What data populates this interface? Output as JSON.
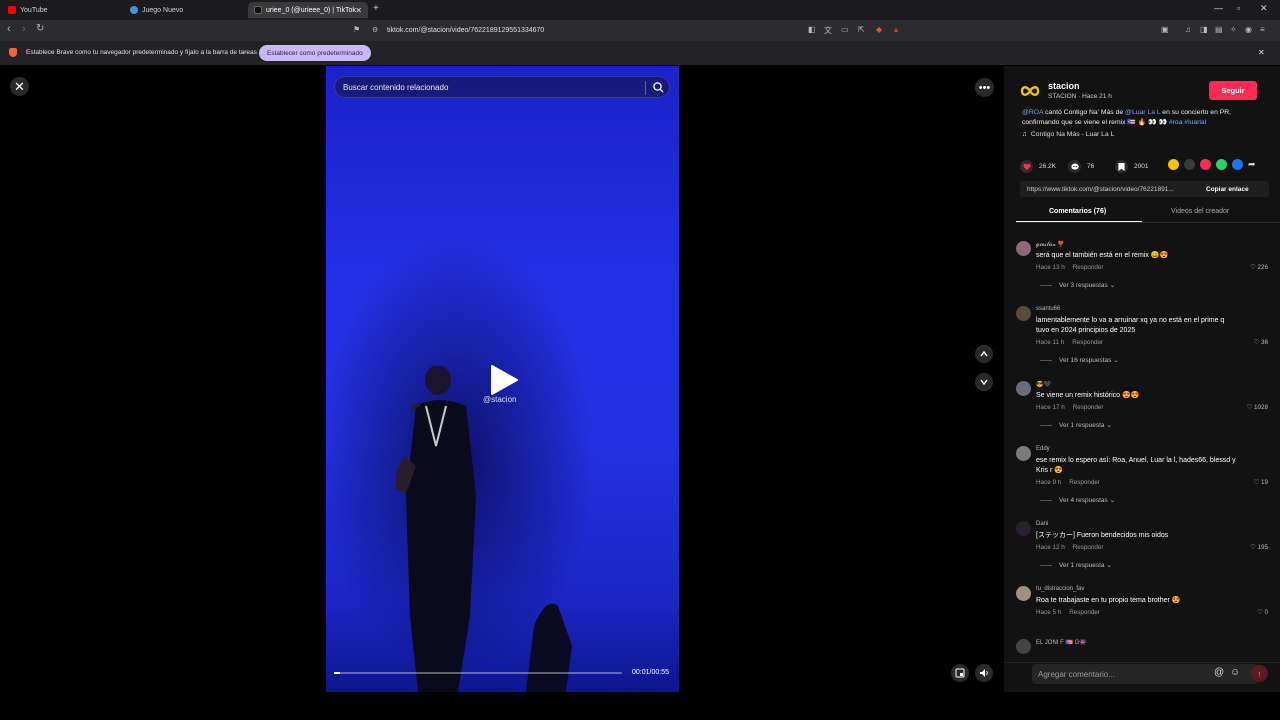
{
  "browser": {
    "tabs": [
      {
        "label": "YouTube",
        "color": "#ff0000"
      },
      {
        "label": "Juego Nuevo",
        "color": "#4a90d9"
      },
      {
        "label": "uriee_0 (@urieee_0) | TikTok",
        "color": "#111111"
      }
    ],
    "url": "tiktok.com/@stacion/video/7622189129551334670",
    "infobar_text": "Establece Brave como tu navegador predeterminado y fíjalo a la barra de tareas",
    "infobar_button": "Establecer como predeterminado"
  },
  "video": {
    "search_placeholder": "Buscar contenido relacionado",
    "watermark": "@stacion",
    "time": "00:01/00:55",
    "progress": 0.02
  },
  "post": {
    "author": "stacion",
    "author_meta": "STACION · Hace 21 h",
    "follow_label": "Seguir",
    "desc_mention1": "@ROA",
    "desc_part1": " cantó Contigo Na' Más de ",
    "desc_mention2": "@Luar La L",
    "desc_part2": " en su concierto en PR, confirmando que se viene el remix ",
    "desc_emoji": "🇵🇷 🔥 👀 👀 ",
    "desc_tags": "#roa #luarlal",
    "music": "Contigo Na Más - Luar La L",
    "likes": "26.2K",
    "comments": "76",
    "saves": "2001",
    "link": "https://www.tiktok.com/@stacion/video/76221891...",
    "copy_label": "Copiar enlace",
    "tab_comments": "Comentarios (76)",
    "tab_videos": "Videos del creador"
  },
  "comments": [
    {
      "user": "𝓰𝓲𝓮𝓼𝓵𝓪𝔁 ❣️",
      "text": "será que el también está en el remix 😄😍",
      "time": "Hace 13 h",
      "reply": "Responder",
      "likes": "226",
      "more": "Ver 3 respuestas ⌄",
      "avatar": "#8a6a7a"
    },
    {
      "user": "ssantu66",
      "text": "lamentablemente lo va a arruinar xq ya no está en el prime q tuvo en 2024 principios de 2025",
      "time": "Hace 11 h",
      "reply": "Responder",
      "likes": "36",
      "more": "Ver 16 respuestas ⌄",
      "avatar": "#5a4a3a"
    },
    {
      "user": "😎🖤",
      "text": "Se viene un remix histórico 😍😍",
      "time": "Hace 17 h",
      "reply": "Responder",
      "likes": "1028",
      "more": "Ver 1 respuesta ⌄",
      "avatar": "#6a6a7a"
    },
    {
      "user": "Eddy",
      "text": "ese remix lo espero así: Roa, Anuel, Luar la l, hades66, blessd y Kris r 😍",
      "time": "Hace 9 h",
      "reply": "Responder",
      "likes": "19",
      "more": "Ver 4 respuestas ⌄",
      "avatar": "#7a7a7a"
    },
    {
      "user": "Dani",
      "text": "[ステッカー] Fueron bendecidos mis oidos",
      "time": "Hace 12 h",
      "reply": "Responder",
      "likes": "195",
      "more": "Ver 1 respuesta ⌄",
      "avatar": "#2a2030"
    },
    {
      "user": "tu_distraccion_fav",
      "text": "Roa te trabajaste en tu propio tema brother 😍",
      "time": "Hace 5 h",
      "reply": "Responder",
      "likes": "0",
      "more": "",
      "avatar": "#a09080"
    },
    {
      "user": "EL JONI F 🇵🇷 G👾",
      "text": "",
      "time": "",
      "reply": "",
      "likes": "",
      "more": "",
      "avatar": "#444444"
    }
  ],
  "comment_input_placeholder": "Agregar comentario..."
}
